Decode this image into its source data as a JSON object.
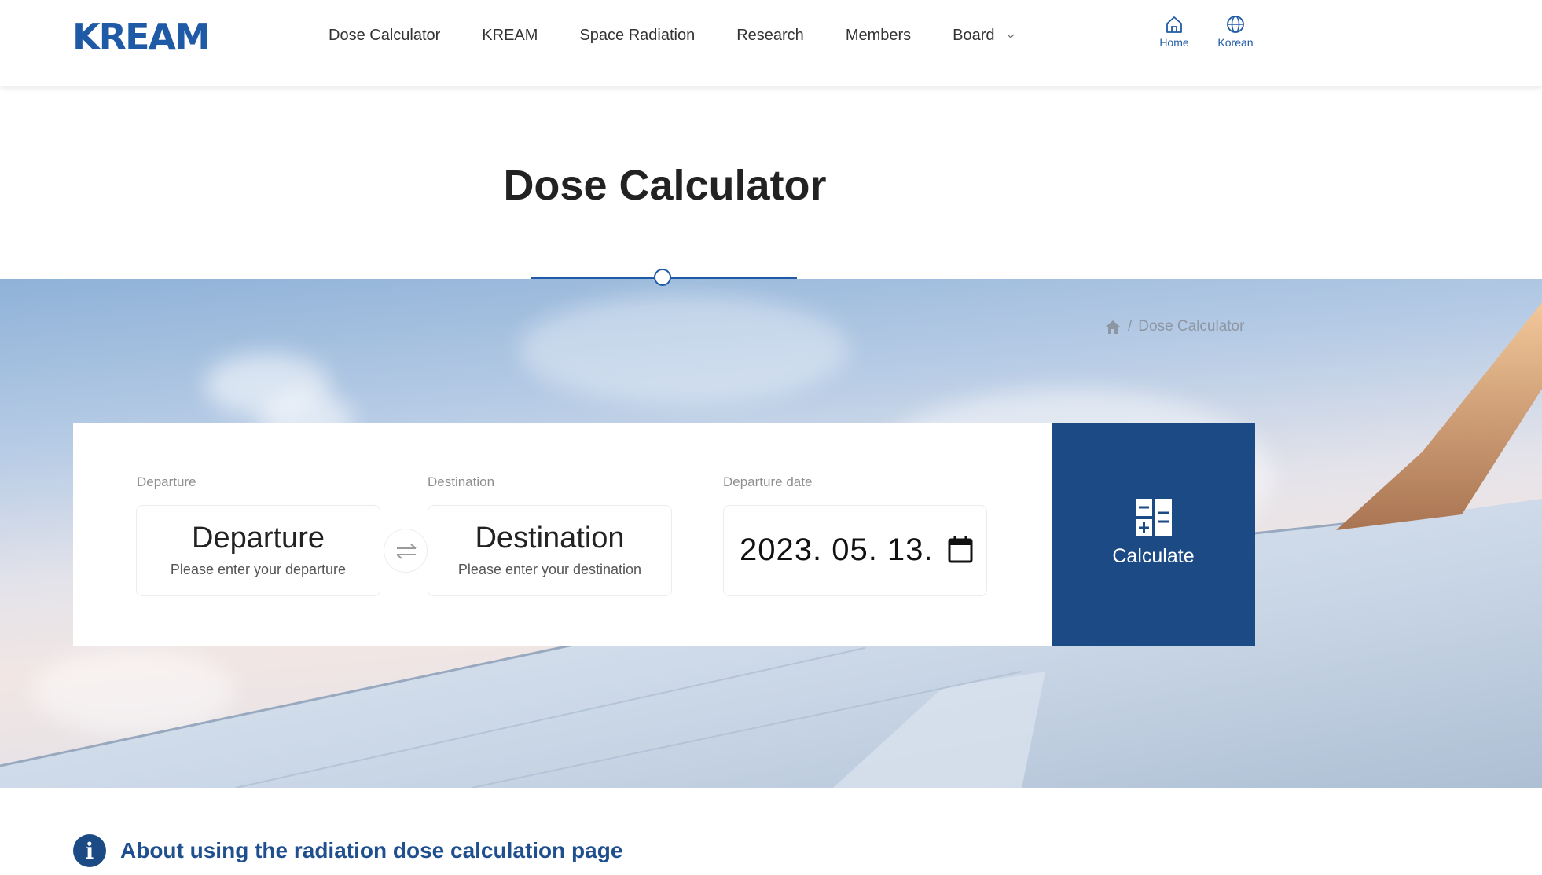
{
  "header": {
    "logo": "KREAM",
    "nav": [
      {
        "label": "Dose Calculator"
      },
      {
        "label": "KREAM"
      },
      {
        "label": "Space Radiation"
      },
      {
        "label": "Research"
      },
      {
        "label": "Members"
      },
      {
        "label": "Board",
        "icon": "chevron-down-icon"
      }
    ],
    "utilities": [
      {
        "label": "Home",
        "icon": "home-icon"
      },
      {
        "label": "Korean",
        "icon": "globe-icon"
      }
    ]
  },
  "page_title": "Dose Calculator",
  "breadcrumb": {
    "icon": "home-icon",
    "separator": "/",
    "current": "Dose Calculator"
  },
  "form": {
    "departure": {
      "label": "Departure",
      "value": "Departure",
      "hint": "Please enter your departure"
    },
    "swap_icon": "swap-arrows-icon",
    "destination": {
      "label": "Destination",
      "value": "Destination",
      "hint": "Please enter your destination"
    },
    "date": {
      "label": "Departure date",
      "value": "2023. 05. 13.",
      "icon": "calendar-icon"
    },
    "calculate": {
      "label": "Calculate",
      "icon": "calculator-icon"
    }
  },
  "info": {
    "icon": "info-icon",
    "text": "About using the radiation dose calculation page"
  },
  "colors": {
    "brand": "#1f5aa6",
    "button": "#1c4a85",
    "info_text": "#1f4f8f"
  }
}
